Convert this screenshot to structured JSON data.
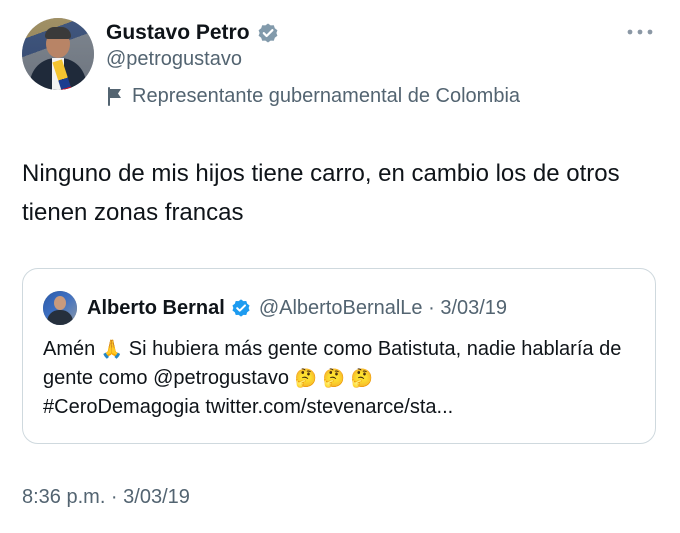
{
  "author": {
    "display_name": "Gustavo Petro",
    "handle": "@petrogustavo",
    "verified_badge_icon": "verified-gray-check-icon",
    "affiliation_icon": "flag-icon",
    "affiliation": "Representante gubernamental de Colombia"
  },
  "tweet": {
    "text": "Ninguno de mis hijos tiene carro, en cambio los de otros tienen zonas francas",
    "timestamp": "8:36 p.m. · 3/03/19"
  },
  "quoted_tweet": {
    "display_name": "Alberto Bernal",
    "handle_and_date": "@AlbertoBernalLe · 3/03/19",
    "verified_badge_icon": "verified-blue-check-icon",
    "text_part1": "Amén",
    "emoji_pray": "🙏",
    "text_part2": " Si hubiera más gente como Batistuta, nadie hablaría de gente como @petrogustavo",
    "emoji_thinking": "🤔 🤔 🤔",
    "text_part3": "#CeroDemagogia twitter.com/stevenarce/sta..."
  },
  "colors": {
    "text_primary": "#0f1419",
    "text_secondary": "#536471",
    "border": "#cfd9de",
    "verified_blue": "#1d9bf0",
    "verified_gray": "#829aab"
  },
  "icons": {
    "more": "more-horizontal-icon"
  }
}
